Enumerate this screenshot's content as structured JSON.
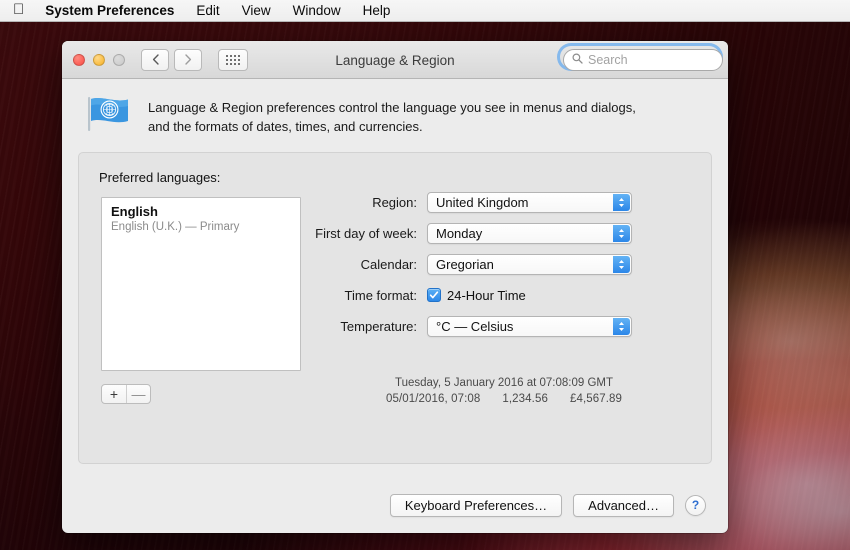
{
  "menubar": {
    "apple_icon": "apple-logo-icon",
    "items": [
      {
        "label": "System Preferences",
        "bold": true
      },
      {
        "label": "Edit"
      },
      {
        "label": "View"
      },
      {
        "label": "Window"
      },
      {
        "label": "Help"
      }
    ]
  },
  "window": {
    "title": "Language & Region",
    "traffic_lights": {
      "close": "close-button",
      "minimize": "minimize-button",
      "zoom": "zoom-button-disabled"
    },
    "toolbar": {
      "back_icon": "chevron-left-icon",
      "forward_icon": "chevron-right-icon",
      "show_all_icon": "grid-icon"
    },
    "search": {
      "placeholder": "Search",
      "value": "",
      "icon": "search-icon",
      "focused": true
    }
  },
  "blurb": {
    "icon": "un-flag-icon",
    "line1": "Language & Region preferences control the language you see in menus and dialogs,",
    "line2": "and the formats of dates, times, and currencies."
  },
  "panel": {
    "preferred_languages_label": "Preferred languages:",
    "languages": [
      {
        "name": "English",
        "detail": "English (U.K.) — Primary"
      }
    ],
    "add_button": "+",
    "remove_button": "—"
  },
  "form": {
    "rows": [
      {
        "label": "Region:",
        "value": "United Kingdom",
        "type": "popup"
      },
      {
        "label": "First day of week:",
        "value": "Monday",
        "type": "popup"
      },
      {
        "label": "Calendar:",
        "value": "Gregorian",
        "type": "popup"
      },
      {
        "label": "Time format:",
        "value": "24-Hour Time",
        "type": "checkbox",
        "checked": true
      },
      {
        "label": "Temperature:",
        "value": "°C — Celsius",
        "type": "popup"
      }
    ]
  },
  "preview": {
    "line1": "Tuesday, 5 January 2016 at 07:08:09 GMT",
    "date_short": "05/01/2016, 07:08",
    "number": "1,234.56",
    "currency": "£4,567.89"
  },
  "footer": {
    "keyboard_button": "Keyboard Preferences…",
    "advanced_button": "Advanced…",
    "help_button": "?"
  },
  "colors": {
    "accent_blue": "#2d88e8",
    "focus_ring": "#74b2ee",
    "close_red": "#fc5d55",
    "minimize_yellow": "#f9bc40",
    "panel_grey": "#e4e4e4",
    "window_grey": "#ececec"
  }
}
